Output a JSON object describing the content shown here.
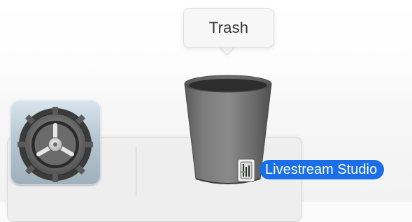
{
  "tooltip": {
    "text": "Trash"
  },
  "dock": {
    "items": [
      {
        "name": "System Preferences",
        "icon": "gear-icon"
      },
      {
        "name": "Trash",
        "icon": "trash-icon"
      }
    ]
  },
  "drag": {
    "label": "Livestream Studio",
    "icon": "livestream-studio-app-icon"
  },
  "colors": {
    "selection_blue": "#1a6fe8",
    "trash_gray": "#7a7a7a"
  }
}
